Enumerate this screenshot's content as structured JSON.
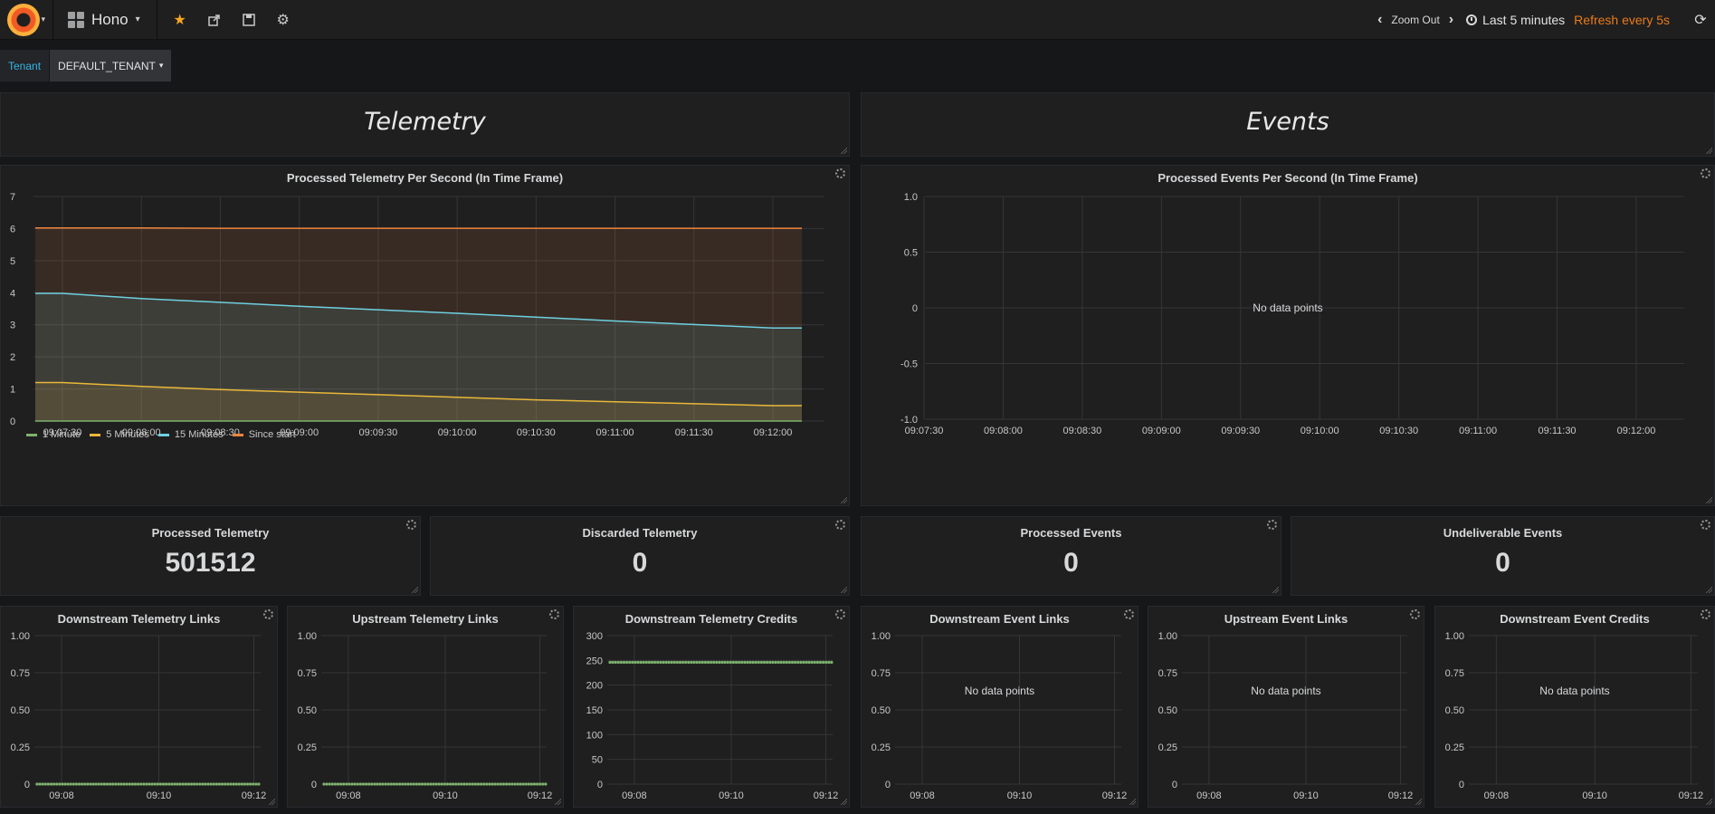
{
  "navbar": {
    "logo_icon": "grafana-logo-icon",
    "dashboard_title": "Hono",
    "zoom_label": "Zoom Out",
    "time_range": "Last 5 minutes",
    "refresh_label": "Refresh every 5s"
  },
  "templating": {
    "label": "Tenant",
    "value": "DEFAULT_TENANT"
  },
  "headers": {
    "telemetry": "Telemetry",
    "events": "Events"
  },
  "graphs": {
    "telemetry_rate": {
      "title": "Processed Telemetry Per Second (In Time Frame)",
      "no_data": ""
    },
    "events_rate": {
      "title": "Processed Events Per Second (In Time Frame)",
      "no_data": "No data points"
    }
  },
  "stats": {
    "processed_telemetry": {
      "title": "Processed Telemetry",
      "value": "501512"
    },
    "discarded_telemetry": {
      "title": "Discarded Telemetry",
      "value": "0"
    },
    "processed_events": {
      "title": "Processed Events",
      "value": "0"
    },
    "undeliverable_events": {
      "title": "Undeliverable Events",
      "value": "0"
    }
  },
  "small_panels": {
    "downstream_telemetry_links": {
      "title": "Downstream Telemetry Links"
    },
    "upstream_telemetry_links": {
      "title": "Upstream Telemetry Links"
    },
    "downstream_telemetry_credits": {
      "title": "Downstream Telemetry Credits"
    },
    "downstream_event_links": {
      "title": "Downstream Event Links",
      "no_data": "No data points"
    },
    "upstream_event_links": {
      "title": "Upstream Event Links",
      "no_data": "No data points"
    },
    "downstream_event_credits": {
      "title": "Downstream Event Credits",
      "no_data": "No data points"
    }
  },
  "colors": {
    "series_1m": "#7eb26d",
    "series_5m": "#eab839",
    "series_15m": "#6ed0e0",
    "series_since_start": "#ef843c",
    "accent_orange": "#eb7b18",
    "variable_label": "#33b5e5"
  },
  "chart_data": [
    {
      "type": "area",
      "title": "Processed Telemetry Per Second (In Time Frame)",
      "x": [
        "09:07:30",
        "09:08:00",
        "09:08:30",
        "09:09:00",
        "09:09:30",
        "09:10:00",
        "09:10:30",
        "09:11:00",
        "09:11:30",
        "09:12:00"
      ],
      "x_ticks": [
        "09:07:30",
        "09:08:00",
        "09:08:30",
        "09:09:00",
        "09:09:30",
        "09:10:00",
        "09:10:30",
        "09:11:00",
        "09:11:30",
        "09:12:00"
      ],
      "y_ticks": [
        0,
        1,
        2,
        3,
        4,
        5,
        6,
        7
      ],
      "ylim": [
        0,
        7
      ],
      "series": [
        {
          "name": "1 Minute",
          "values": [
            0,
            0,
            0,
            0,
            0,
            0,
            0,
            0,
            0,
            0
          ]
        },
        {
          "name": "5 Minutes",
          "values": [
            1.2,
            1.08,
            0.98,
            0.9,
            0.82,
            0.74,
            0.66,
            0.6,
            0.54,
            0.48
          ]
        },
        {
          "name": "15 Minutes",
          "values": [
            3.98,
            3.82,
            3.7,
            3.58,
            3.47,
            3.36,
            3.24,
            3.12,
            3.01,
            2.9
          ]
        },
        {
          "name": "Since start",
          "values": [
            6.02,
            6.02,
            6.01,
            6.01,
            6.01,
            6.01,
            6.01,
            6.01,
            6.01,
            6.01
          ]
        }
      ],
      "legend": "bottom-left",
      "grid": true
    },
    {
      "type": "line",
      "title": "Processed Events Per Second (In Time Frame)",
      "x_ticks": [
        "09:07:30",
        "09:08:00",
        "09:08:30",
        "09:09:00",
        "09:09:30",
        "09:10:00",
        "09:10:30",
        "09:11:00",
        "09:11:30",
        "09:12:00"
      ],
      "y_ticks": [
        "1.0",
        "0.5",
        "0",
        "-0.5",
        "-1.0"
      ],
      "ylim": [
        -1,
        1
      ],
      "series": [],
      "grid": true
    },
    {
      "type": "scatter",
      "title": "Downstream Telemetry Links",
      "x_ticks": [
        "09:08",
        "09:10",
        "09:12"
      ],
      "y_ticks": [
        "1.00",
        "0.75",
        "0.50",
        "0.25",
        "0"
      ],
      "ylim": [
        0,
        1
      ],
      "series": [
        {
          "name": "",
          "constant": 0
        }
      ],
      "grid": true
    },
    {
      "type": "scatter",
      "title": "Upstream Telemetry Links",
      "x_ticks": [
        "09:08",
        "09:10",
        "09:12"
      ],
      "y_ticks": [
        "1.00",
        "0.75",
        "0.50",
        "0.25",
        "0"
      ],
      "ylim": [
        0,
        1
      ],
      "series": [
        {
          "name": "",
          "constant": 0
        }
      ],
      "grid": true
    },
    {
      "type": "scatter",
      "title": "Downstream Telemetry Credits",
      "x_ticks": [
        "09:08",
        "09:10",
        "09:12"
      ],
      "y_ticks": [
        "300",
        "250",
        "200",
        "150",
        "100",
        "50",
        "0"
      ],
      "ylim": [
        0,
        300
      ],
      "series": [
        {
          "name": "",
          "constant": 246
        }
      ],
      "grid": true
    },
    {
      "type": "line",
      "title": "Downstream Event Links",
      "x_ticks": [
        "09:08",
        "09:10",
        "09:12"
      ],
      "y_ticks": [
        "1.00",
        "0.75",
        "0.50",
        "0.25",
        "0"
      ],
      "ylim": [
        0,
        1
      ],
      "series": [],
      "grid": true
    },
    {
      "type": "line",
      "title": "Upstream Event Links",
      "x_ticks": [
        "09:08",
        "09:10",
        "09:12"
      ],
      "y_ticks": [
        "1.00",
        "0.75",
        "0.50",
        "0.25",
        "0"
      ],
      "ylim": [
        0,
        1
      ],
      "series": [],
      "grid": true
    },
    {
      "type": "line",
      "title": "Downstream Event Credits",
      "x_ticks": [
        "09:08",
        "09:10",
        "09:12"
      ],
      "y_ticks": [
        "1.00",
        "0.75",
        "0.50",
        "0.25",
        "0"
      ],
      "ylim": [
        0,
        1
      ],
      "series": [],
      "grid": true
    }
  ]
}
